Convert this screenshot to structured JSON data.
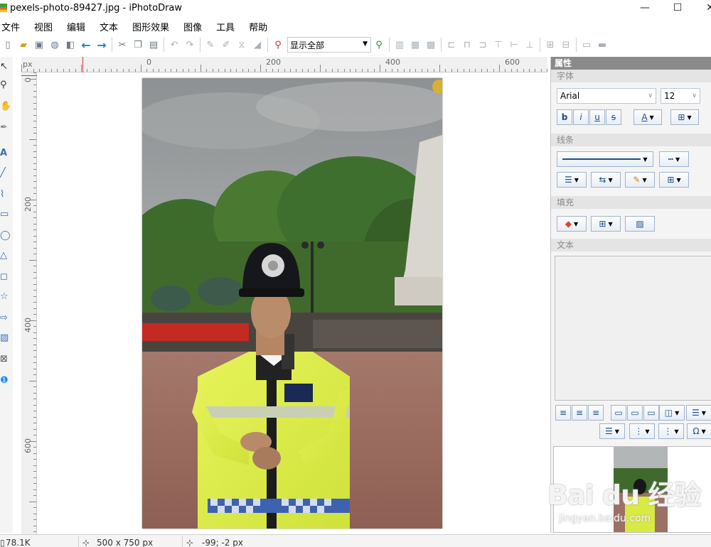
{
  "window": {
    "title": "pexels-photo-89427.jpg - iPhotoDraw",
    "minimize": "—",
    "maximize": "☐",
    "close": "✕"
  },
  "menu": [
    "文件",
    "视图",
    "编辑",
    "文本",
    "图形效果",
    "图像",
    "工具",
    "帮助"
  ],
  "toolbar": {
    "zoom_value": "显示全部"
  },
  "ruler": {
    "unit": "px",
    "top_labels": [
      "0",
      "200",
      "400",
      "600"
    ],
    "left_labels": [
      "0",
      "200",
      "400",
      "600"
    ]
  },
  "panel": {
    "title": "属性",
    "font_section": "字体",
    "font_name": "Arial",
    "font_size": "12",
    "bold": "b",
    "italic": "i",
    "underline": "u",
    "strike": "s",
    "font_color_glyph": "A",
    "line_section": "线条",
    "fill_section": "填充",
    "text_section": "文本"
  },
  "status": {
    "file_size": "78.1K",
    "dimensions": "500 x 750 px",
    "cursor": "-99; -2 px"
  },
  "watermark": {
    "brand": "Bai du 经验",
    "url": "jingyan.baidu.com"
  },
  "colors": {
    "accent_blue": "#1e7fd6",
    "panel_title_bg": "#8a8a8a",
    "ruler_marker": "#e03030"
  }
}
